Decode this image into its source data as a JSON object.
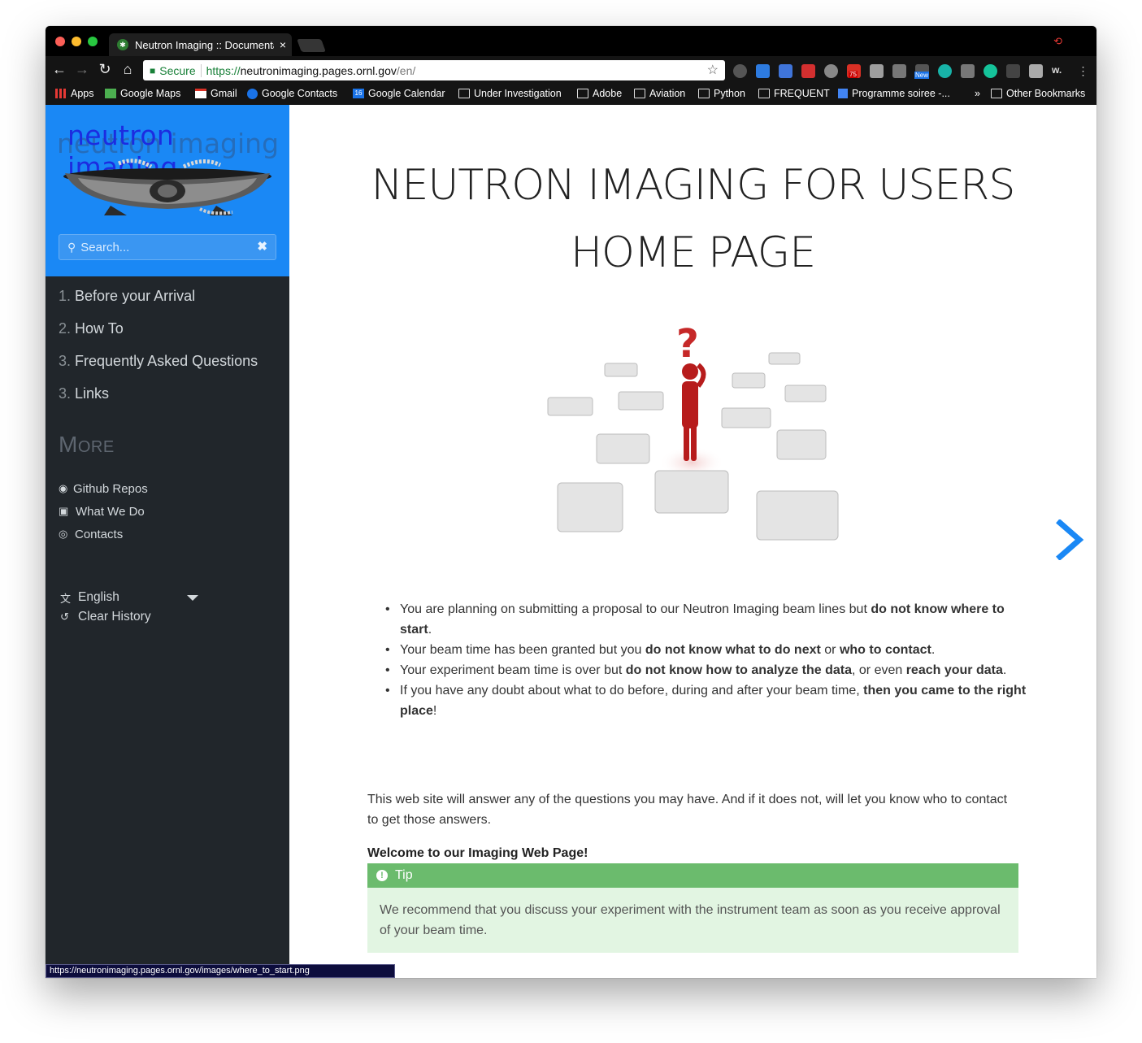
{
  "browser": {
    "tab_title": "Neutron Imaging :: Documenta",
    "tab_close": "×",
    "secure_label": "Secure",
    "url_scheme": "https://",
    "url_host": "neutronimaging.pages.ornl.gov",
    "url_path": "/en/",
    "bookmarks": [
      {
        "label": "Apps",
        "icon": "apps-grid-icon"
      },
      {
        "label": "Google Maps",
        "icon": "maps-icon"
      },
      {
        "label": "Gmail",
        "icon": "gmail-icon"
      },
      {
        "label": "Google Contacts",
        "icon": "contacts-icon"
      },
      {
        "label": "Google Calendar",
        "icon": "calendar-icon"
      },
      {
        "label": "Under Investigation",
        "icon": "folder-icon"
      },
      {
        "label": "Adobe",
        "icon": "folder-icon"
      },
      {
        "label": "Aviation",
        "icon": "folder-icon"
      },
      {
        "label": "Python",
        "icon": "folder-icon"
      },
      {
        "label": "FREQUENT",
        "icon": "folder-icon"
      },
      {
        "label": "Programme soiree -...",
        "icon": "doc-icon"
      }
    ],
    "bookmarks_overflow": "»",
    "other_bookmarks": "Other Bookmarks",
    "calendar_badge": "16",
    "mail_badge": "75",
    "new_badge": "New",
    "status_url": "https://neutronimaging.pages.ornl.gov/images/where_to_start.png"
  },
  "sidebar": {
    "logo_text": "neutron imaging",
    "search_placeholder": "Search...",
    "menu": [
      {
        "num": "1.",
        "label": "Before your Arrival"
      },
      {
        "num": "2.",
        "label": "How To"
      },
      {
        "num": "3.",
        "label": "Frequently Asked Questions"
      },
      {
        "num": "3.",
        "label": "Links"
      }
    ],
    "more_title": "More",
    "more_links": [
      {
        "label": "Github Repos",
        "icon": "github-icon"
      },
      {
        "label": "What We Do",
        "icon": "camera-icon"
      },
      {
        "label": "Contacts",
        "icon": "user-circle-icon"
      }
    ],
    "language": "English",
    "clear_history": "Clear History"
  },
  "main": {
    "title_line1": "NEUTRON IMAGING FOR USERS",
    "title_line2": "HOME PAGE",
    "bullets": [
      {
        "parts": [
          "You are planning on submitting a proposal to our Neutron Imaging beam lines but ",
          "do not know where to start",
          "."
        ]
      },
      {
        "parts": [
          "Your beam time has been granted but you ",
          "do not know what to do next",
          " or ",
          "who to contact",
          "."
        ]
      },
      {
        "parts": [
          "Your experiment beam time is over but ",
          "do not know how to analyze the data",
          ", or even ",
          "reach your data",
          "."
        ]
      },
      {
        "parts": [
          "If you have any doubt about what to do before, during and after your beam time, ",
          "then you came to the right place",
          "!"
        ]
      }
    ],
    "intro": "This web site will answer any of the questions you may have. And if it does not, will let you know who to contact to get those answers.",
    "welcome": "Welcome to our Imaging Web Page!",
    "tip_title": "Tip",
    "tip_body": "We recommend that you discuss your experiment with the instrument team as soon as you receive approval of your beam time."
  }
}
